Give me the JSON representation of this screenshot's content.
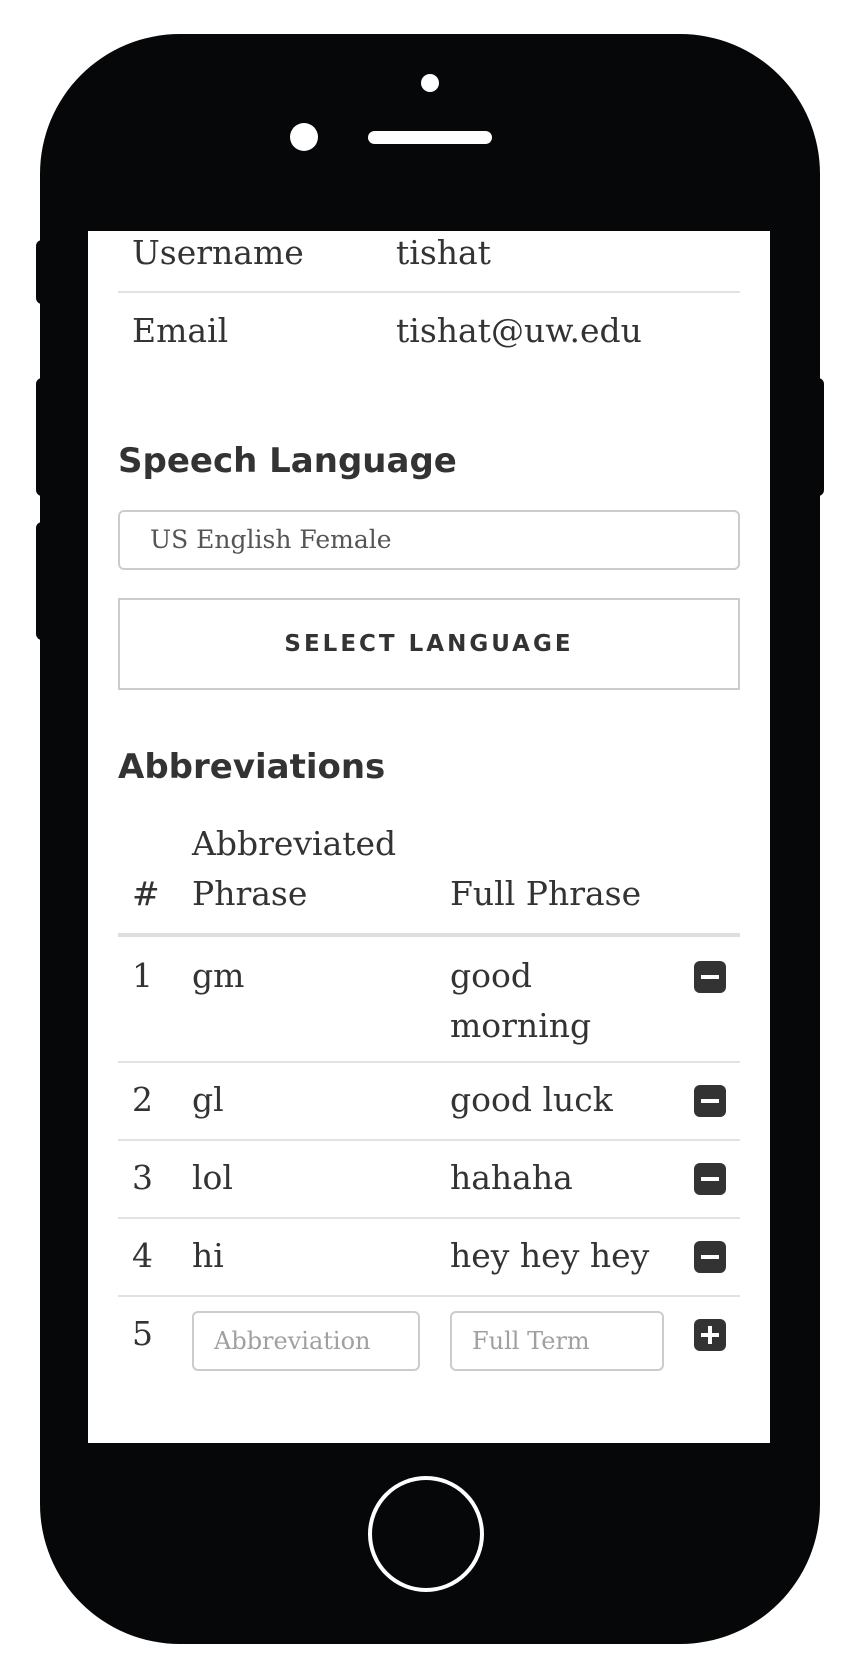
{
  "account": {
    "username_label": "Username",
    "username_value": "tishat",
    "email_label": "Email",
    "email_value": "tishat@uw.edu"
  },
  "speech": {
    "title": "Speech Language",
    "current_language": "US English Female",
    "select_button": "SELECT LANGUAGE"
  },
  "abbreviations": {
    "title": "Abbreviations",
    "headers": {
      "num": "#",
      "abbr_line1": "Abbreviated",
      "abbr_line2": "Phrase",
      "full": "Full Phrase"
    },
    "rows": [
      {
        "num": "1",
        "abbr": "gm",
        "full_line1": "good",
        "full_line2": "morning"
      },
      {
        "num": "2",
        "abbr": "gl",
        "full": "good luck"
      },
      {
        "num": "3",
        "abbr": "lol",
        "full": "hahaha"
      },
      {
        "num": "4",
        "abbr": "hi",
        "full": "hey hey hey"
      }
    ],
    "new_row": {
      "num": "5",
      "abbr_placeholder": "Abbreviation",
      "full_placeholder": "Full Term"
    }
  },
  "icons": {
    "remove": "minus-square-icon",
    "add": "plus-square-icon"
  },
  "colors": {
    "phone_body": "#060708",
    "text": "#333333",
    "border": "#cccccc"
  }
}
